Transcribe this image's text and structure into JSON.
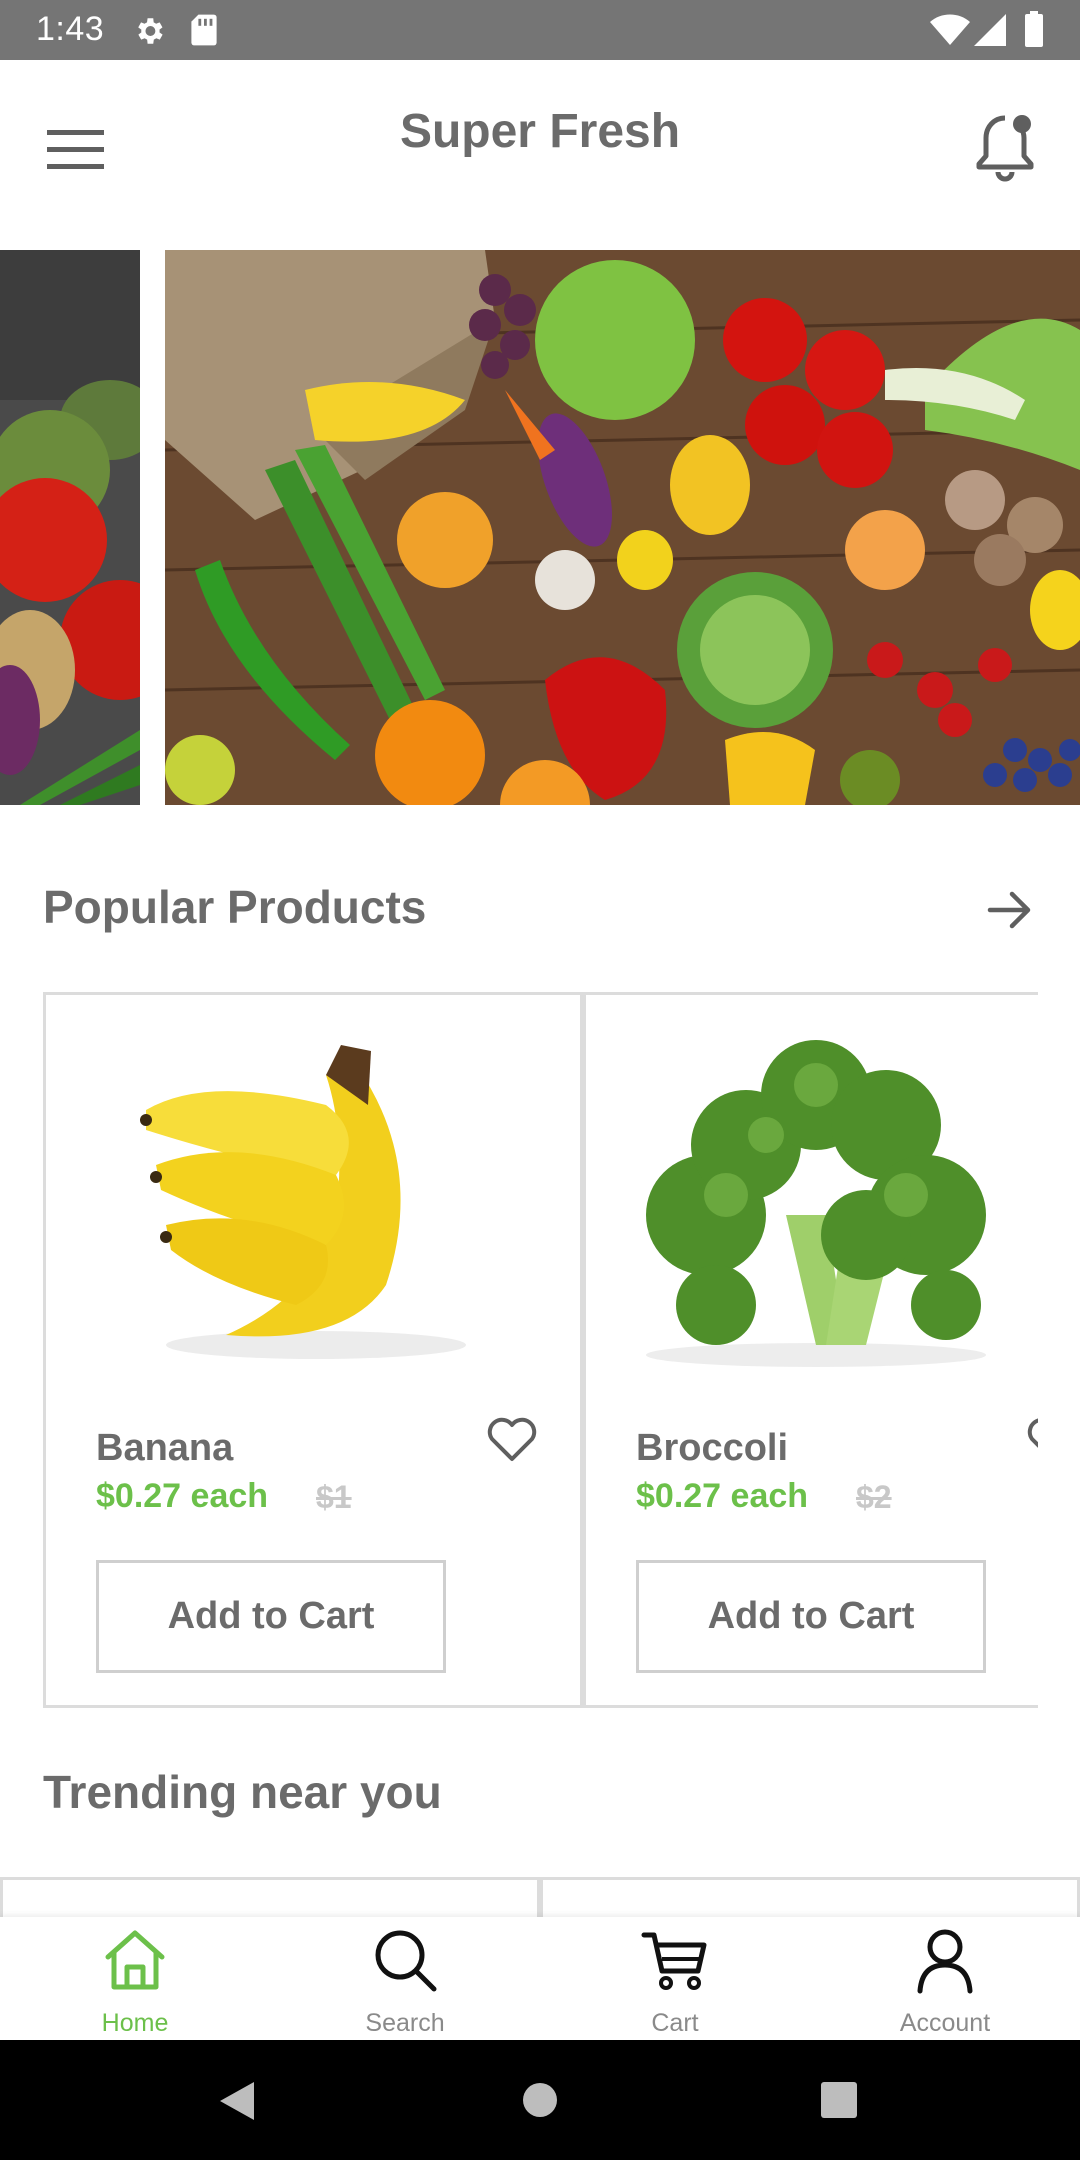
{
  "status_bar": {
    "time": "1:43",
    "icons": [
      "gear-icon",
      "sd-card-icon",
      "wifi-icon",
      "signal-icon",
      "battery-icon"
    ]
  },
  "app_bar": {
    "title": "Super Fresh",
    "menu_icon": "hamburger-menu-icon",
    "notification_icon": "notification-bell-icon"
  },
  "banner": {
    "description_icon": "fresh-produce-banner-image"
  },
  "popular": {
    "title": "Popular Products",
    "see_all_icon": "arrow-right-icon",
    "products": [
      {
        "name": "Banana",
        "price": "$0.27 each",
        "old_price": "$1",
        "button": "Add to Cart",
        "image_icon": "banana-image"
      },
      {
        "name": "Broccoli",
        "price": "$0.27 each",
        "old_price": "$2",
        "button": "Add to Cart",
        "image_icon": "broccoli-image"
      }
    ]
  },
  "trending": {
    "title": "Trending near you"
  },
  "bottom_nav": {
    "items": [
      {
        "label": "Home",
        "icon": "home-icon",
        "active": true
      },
      {
        "label": "Search",
        "icon": "search-icon",
        "active": false
      },
      {
        "label": "Cart",
        "icon": "cart-icon",
        "active": false
      },
      {
        "label": "Account",
        "icon": "account-icon",
        "active": false
      }
    ]
  },
  "colors": {
    "accent": "#6cc04a",
    "status_bar": "#757575",
    "text": "#6b6b6b",
    "strike": "#c8c8c8"
  }
}
